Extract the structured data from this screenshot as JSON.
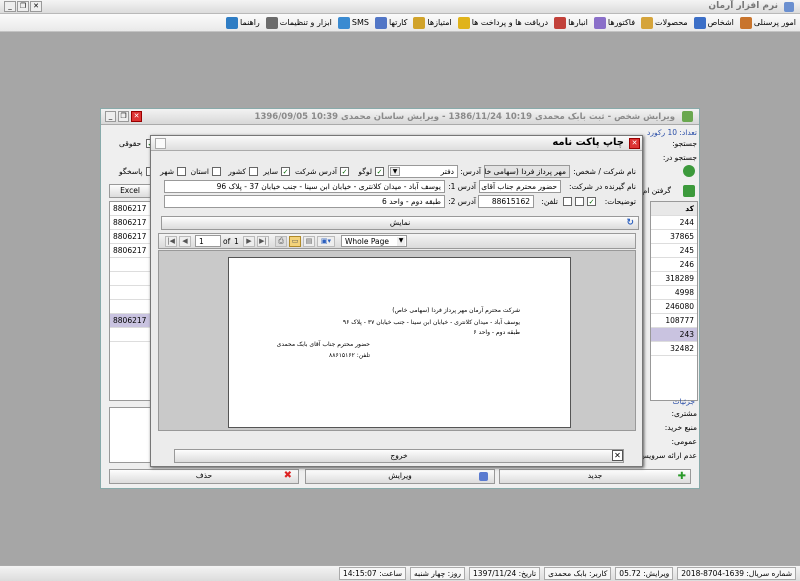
{
  "app": {
    "title": "نرم افزار آرمان"
  },
  "menu": [
    {
      "label": "امور پرسنلی",
      "icon": "people-icon",
      "color": "#c8742c"
    },
    {
      "label": "اشخاص",
      "icon": "users-icon",
      "color": "#3c6fc7"
    },
    {
      "label": "محصولات",
      "icon": "box-icon",
      "color": "#d5a43b"
    },
    {
      "label": "فاکتورها",
      "icon": "invoice-icon",
      "color": "#8a6fc9"
    },
    {
      "label": "انبارها",
      "icon": "warehouse-icon",
      "color": "#c2413a"
    },
    {
      "label": "دریافت ها و پرداخت ها",
      "icon": "money-icon",
      "color": "#e0b31b"
    },
    {
      "label": "امتیازها",
      "icon": "star-icon",
      "color": "#d1a32a"
    },
    {
      "label": "کارتها",
      "icon": "card-icon",
      "color": "#5276c6"
    },
    {
      "label": "SMS",
      "icon": "sms-icon",
      "color": "#3b8bd1"
    },
    {
      "label": "ابزار و تنظیمات",
      "icon": "tools-icon",
      "color": "#6b6b6b"
    },
    {
      "label": "راهنما",
      "icon": "help-icon",
      "color": "#2f7dc4"
    }
  ],
  "person_window": {
    "title": "ویرایش شخص - ثبت  بابک محمدی 10:19 1386/11/24 - ویرایش  ساسان محمدی 10:39 1396/09/05",
    "title_short": "همه اش",
    "count_label": "تعداد: 10 رکورد",
    "search_label": "جستجو:",
    "search_in_label": "جستجو در:",
    "legal_label": "حقوقی",
    "excel_button": "Excel",
    "get_label": "گرفتن ام",
    "answer_label": "پاسخگو",
    "code_header": "کد",
    "codes": [
      "244",
      "37865",
      "245",
      "246",
      "318289",
      "4998",
      "246080",
      "108777",
      "243",
      "32482"
    ],
    "phones": [
      "8806217",
      "8806217",
      "8806217",
      "8806217",
      "",
      "",
      "",
      "",
      "8806217",
      ""
    ],
    "details_label": "جزئیات",
    "customer_label": "مشتری:",
    "source_label": "منبع خرید:",
    "general_label": "عمومی:",
    "no_service_label": "عدم ارائه سرویس:",
    "new_button": "جدید",
    "edit_button": "ویرایش",
    "delete_button": "حذف"
  },
  "dialog": {
    "title": "چاپ پاکت نامه",
    "company_label": "نام شرکت / شخص:",
    "company_value": "مهر پرداز فردا (سهامی خاص)",
    "address_label": "آدرس:",
    "address_type": "دفتر",
    "logo_label": "لوگو",
    "company_address_label": "آدرس شرکت",
    "other_label": "سایر",
    "country_label": "کشور",
    "province_label": "استان",
    "city_label": "شهر",
    "receiver_label": "نام گیرنده در شرکت:",
    "receiver_value": "حضور محترم جناب آقای بابک",
    "address1_label": "آدرس 1:",
    "address1_value": "یوسف آباد - میدان کلانتری - خیابان ابن سینا - جنب خیابان 37 - پلاک 96",
    "notes_label": "توضیحات:",
    "phone_label": "تلفن:",
    "phone_value": "88615162",
    "address2_label": "آدرس 2:",
    "address2_value": "طبقه دوم - واحد 6",
    "show_button": "نمایش",
    "exit_button": "خروج",
    "viewer": {
      "page": "1",
      "of": "of",
      "total": "1",
      "zoom": "Whole Page"
    },
    "paper_lines": [
      "شرکت محترم آرمان مهر پرداز فردا (سهامی خاص)",
      "یوسف آباد - میدان کلانتری - خیابان ابن سینا - جنب خیابان ۳۷ - پلاک ۹۶",
      "طبقه دوم - واحد ۶",
      "حضور محترم جناب آقای بابک محمدی",
      "تلفن: ۸۸۶۱۵۱۶۲"
    ]
  },
  "status": {
    "serial": "شماره سریال: 1639-8704-2018",
    "version": "ویرایش: 05.72",
    "user": "کاربر: بابک محمدی",
    "date": "تاریخ: 1397/11/24",
    "day": "روز: چهار شنبه",
    "time": "ساعت: 14:15:07"
  }
}
